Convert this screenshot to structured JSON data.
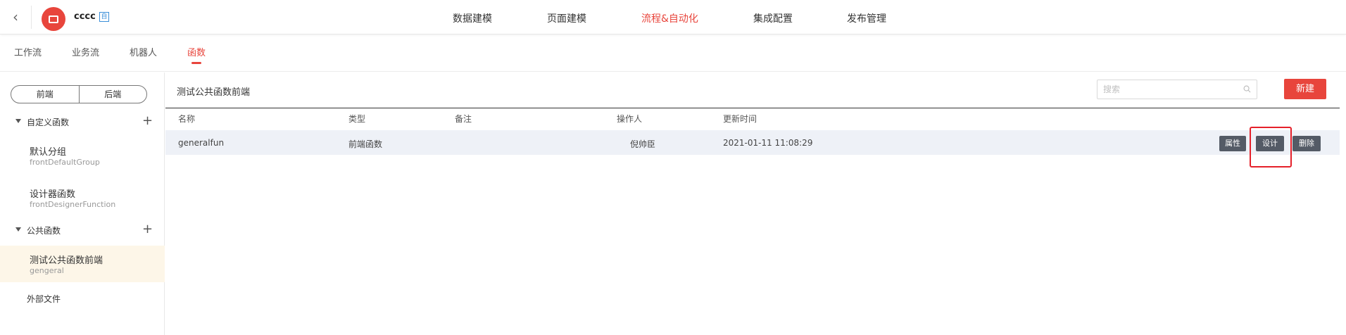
{
  "header": {
    "app_name": "cccc",
    "app_badge": "自",
    "nav": [
      "数据建模",
      "页面建模",
      "流程&自动化",
      "集成配置",
      "发布管理"
    ],
    "active_nav": "流程&自动化",
    "accent_color": "#e8453c"
  },
  "subtabs": [
    "工作流",
    "业务流",
    "机器人",
    "函数"
  ],
  "active_subtab": "函数",
  "sidebar": {
    "toggle": [
      "前端",
      "后端"
    ],
    "sections": [
      {
        "title": "自定义函数",
        "items": [
          {
            "name": "默认分组",
            "code": "frontDefaultGroup"
          },
          {
            "name": "设计器函数",
            "code": "frontDesignerFunction"
          }
        ]
      },
      {
        "title": "公共函数",
        "items": [
          {
            "name": "测试公共函数前端",
            "code": "gengeral"
          }
        ]
      }
    ],
    "external_files": "外部文件"
  },
  "main": {
    "heading": "测试公共函数前端",
    "search_placeholder": "搜索",
    "new_button": "新建",
    "columns": [
      "名称",
      "类型",
      "备注",
      "操作人",
      "更新时间"
    ],
    "rows": [
      {
        "name": "generalfun",
        "type": "前端函数",
        "note": "",
        "operator": "倪帅臣",
        "updated": "2021-01-11 11:08:29"
      }
    ],
    "actions": [
      "属性",
      "设计",
      "删除"
    ]
  }
}
